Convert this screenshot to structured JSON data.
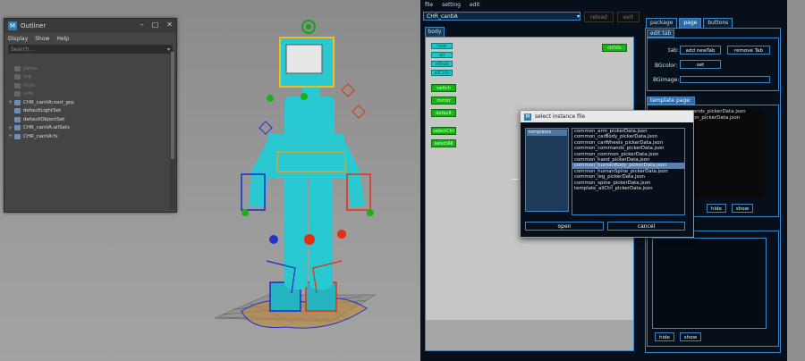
{
  "outliner": {
    "title": "Outliner",
    "menu": [
      "Display",
      "Show",
      "Help"
    ],
    "search_placeholder": "Search...",
    "items": [
      {
        "label": "persp",
        "dim": true
      },
      {
        "label": "top",
        "dim": true
      },
      {
        "label": "front",
        "dim": true
      },
      {
        "label": "side",
        "dim": true
      },
      {
        "label": "CHR_cantiA:root_grp",
        "dim": false,
        "expand": "+"
      },
      {
        "label": "defaultLightSet",
        "dim": false
      },
      {
        "label": "defaultObjectSet",
        "dim": false
      },
      {
        "label": "CHR_cantiA:allSets",
        "dim": false,
        "expand": "+"
      },
      {
        "label": "CHR_cantiA:fx",
        "dim": false,
        "expand": "+"
      }
    ]
  },
  "picker": {
    "menu": [
      "file",
      "setting",
      "edit"
    ],
    "character_select": "CHR_cantiA",
    "reload_label": "reload",
    "exit_label": "exit",
    "body_tab": "body",
    "canvas_buttons": {
      "ctrl_vis": "ctrlVis",
      "root": "root",
      "all": "all",
      "all_sub": "allSub",
      "all_ctrls": "allCtrls",
      "switch": "switch",
      "mirror": "mirror",
      "default": "default",
      "select_ctrl": "selectCtrl",
      "select_all": "selectAll"
    },
    "right_tabs": [
      "package",
      "page",
      "buttons"
    ],
    "edit_tab_label": "edit tab",
    "tab_label": "tab:",
    "add_new_tab": "add newTab",
    "remove_tab": "remove Tab",
    "bg_color_label": "BGcolor:",
    "set_label": "set",
    "bg_image_label": "BGimage:",
    "template_label": "template page:",
    "template_items": [
      "common_commands_pickerData.json",
      "common_common_pickerData.json"
    ],
    "hide_label": "hide",
    "show_label": "show",
    "hide_label_2": "hide",
    "show_label_2": "show"
  },
  "dialog": {
    "title": "select instance file",
    "folder_selected": "templates",
    "files": [
      "common_arm_pickerData.json",
      "common_carBody_pickerData.json",
      "common_carWheels_pickerData.json",
      "common_commands_pickerData.json",
      "common_common_pickerData.json",
      "common_hand_pickerData.json",
      "common_humanBody_pickerData.json",
      "common_humanSpine_pickerData.json",
      "common_leg_pickerData.json",
      "common_spine_pickerData.json",
      "template_allCtrl_pickerData.json"
    ],
    "highlighted_index": 6,
    "open_label": "open",
    "cancel_label": "cancel"
  },
  "colors": {
    "accent_blue": "#3b86c6",
    "ctrl_green": "#16b216",
    "ctrl_cyan": "#19c8c8",
    "panel_bg": "#07101a"
  }
}
